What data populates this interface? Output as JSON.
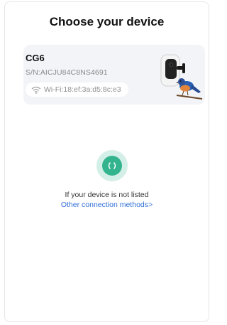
{
  "page": {
    "title": "Choose your device"
  },
  "device_card": {
    "name": "CG6",
    "serial": "S/N:AICJU84C8NS4691",
    "wifi": "Wi-Fi:18:ef:3a:d5:8c:e3",
    "wifi_icon": "wifi-icon",
    "image": "camera-with-bird"
  },
  "scan": {
    "icon": "scanning-icon",
    "accent_color": "#33b48e"
  },
  "help": {
    "not_listed": "If your device is not listed",
    "other_methods": "Other connection methods>",
    "link_color": "#2f6fd6"
  }
}
